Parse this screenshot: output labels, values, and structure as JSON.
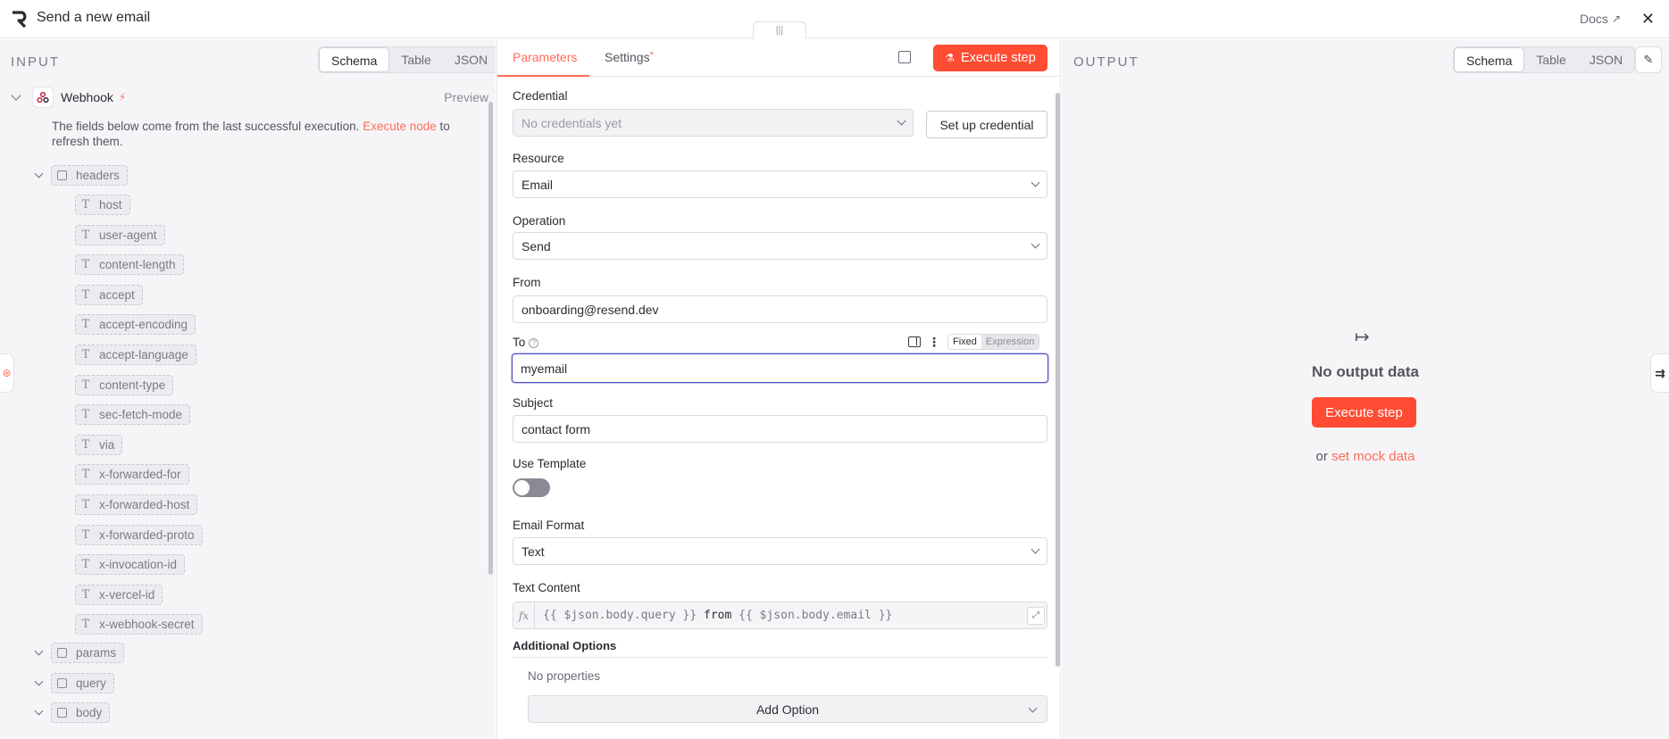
{
  "header": {
    "title": "Send a new email",
    "docs_label": "Docs",
    "close_symbol": "✕",
    "handle_symbol": "|||"
  },
  "input": {
    "label": "INPUT",
    "view_tabs": [
      "Schema",
      "Table",
      "JSON"
    ],
    "active_tab": "Schema",
    "node_name": "Webhook",
    "preview_label": "Preview",
    "note_before": "The fields below come from the last successful execution.",
    "note_link": "Execute node",
    "note_after": "to refresh them.",
    "headers_label": "headers",
    "header_fields": [
      "host",
      "user-agent",
      "content-length",
      "accept",
      "accept-encoding",
      "accept-language",
      "content-type",
      "sec-fetch-mode",
      "via",
      "x-forwarded-for",
      "x-forwarded-host",
      "x-forwarded-proto",
      "x-invocation-id",
      "x-vercel-id",
      "x-webhook-secret"
    ],
    "groups": [
      "params",
      "query",
      "body"
    ]
  },
  "params": {
    "tabs": {
      "parameters": "Parameters",
      "settings": "Settings",
      "settings_marker": "*"
    },
    "execute_label": "Execute step",
    "credential": {
      "label": "Credential",
      "placeholder": "No credentials yet",
      "setup_label": "Set up credential"
    },
    "resource": {
      "label": "Resource",
      "value": "Email"
    },
    "operation": {
      "label": "Operation",
      "value": "Send"
    },
    "from": {
      "label": "From",
      "value": "onboarding@resend.dev"
    },
    "to": {
      "label": "To",
      "value": "myemail",
      "mode_fixed": "Fixed",
      "mode_expression": "Expression"
    },
    "subject": {
      "label": "Subject",
      "value": "contact form"
    },
    "use_template": {
      "label": "Use Template",
      "enabled": false
    },
    "email_format": {
      "label": "Email Format",
      "value": "Text"
    },
    "text_content": {
      "label": "Text Content",
      "fx": "fx",
      "expr_part1": "{{ $json.body.query }}",
      "expr_mid": " from ",
      "expr_part2": "{{ $json.body.email }}"
    },
    "additional_options": {
      "label": "Additional Options",
      "empty_text": "No properties",
      "add_label": "Add Option"
    }
  },
  "output": {
    "label": "OUTPUT",
    "view_tabs": [
      "Schema",
      "Table",
      "JSON"
    ],
    "active_tab": "Schema",
    "empty_title": "No output data",
    "execute_label": "Execute step",
    "mock_prefix": "or",
    "mock_link": "set mock data"
  },
  "colors": {
    "accent": "#ff4c33",
    "link": "#ff6d5a",
    "focus": "#4d4dbf"
  }
}
